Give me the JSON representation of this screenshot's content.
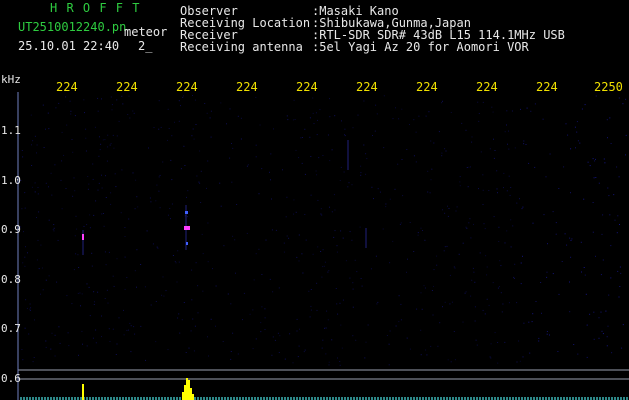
{
  "header": {
    "app_name": "H R O F F T",
    "filename": "UT2510012240.pn",
    "tag": "meteor",
    "datetime": "25.10.01 22:40",
    "count": "2_"
  },
  "info": {
    "labels": [
      "Observer",
      "Receiving Location",
      "Receiver",
      "Receiving antenna"
    ],
    "values": [
      ":Masaki Kano",
      ":Shibukawa,Gunma,Japan",
      ":RTL-SDR SDR# 43dB L15 114.1MHz USB",
      ":5el Yagi Az 20 for Aomori VOR"
    ]
  },
  "time_axis": {
    "ticks": [
      "224",
      "224",
      "224",
      "224",
      "224",
      "224",
      "224",
      "224",
      "224",
      "2250"
    ]
  },
  "freq_axis": {
    "unit": "kHz",
    "ticks": [
      "1.1",
      "1.0",
      "0.9",
      "0.8",
      "0.7",
      "0.6"
    ]
  },
  "colors": {
    "background": "#000000",
    "title_green": "#2ecc40",
    "text_white": "#e8e8e8",
    "tick_yellow": "#f0e000",
    "echo_magenta": "#ff40ff",
    "spectrum_yellow": "#ffff00",
    "noise_blue": "#1a1aa0"
  }
}
